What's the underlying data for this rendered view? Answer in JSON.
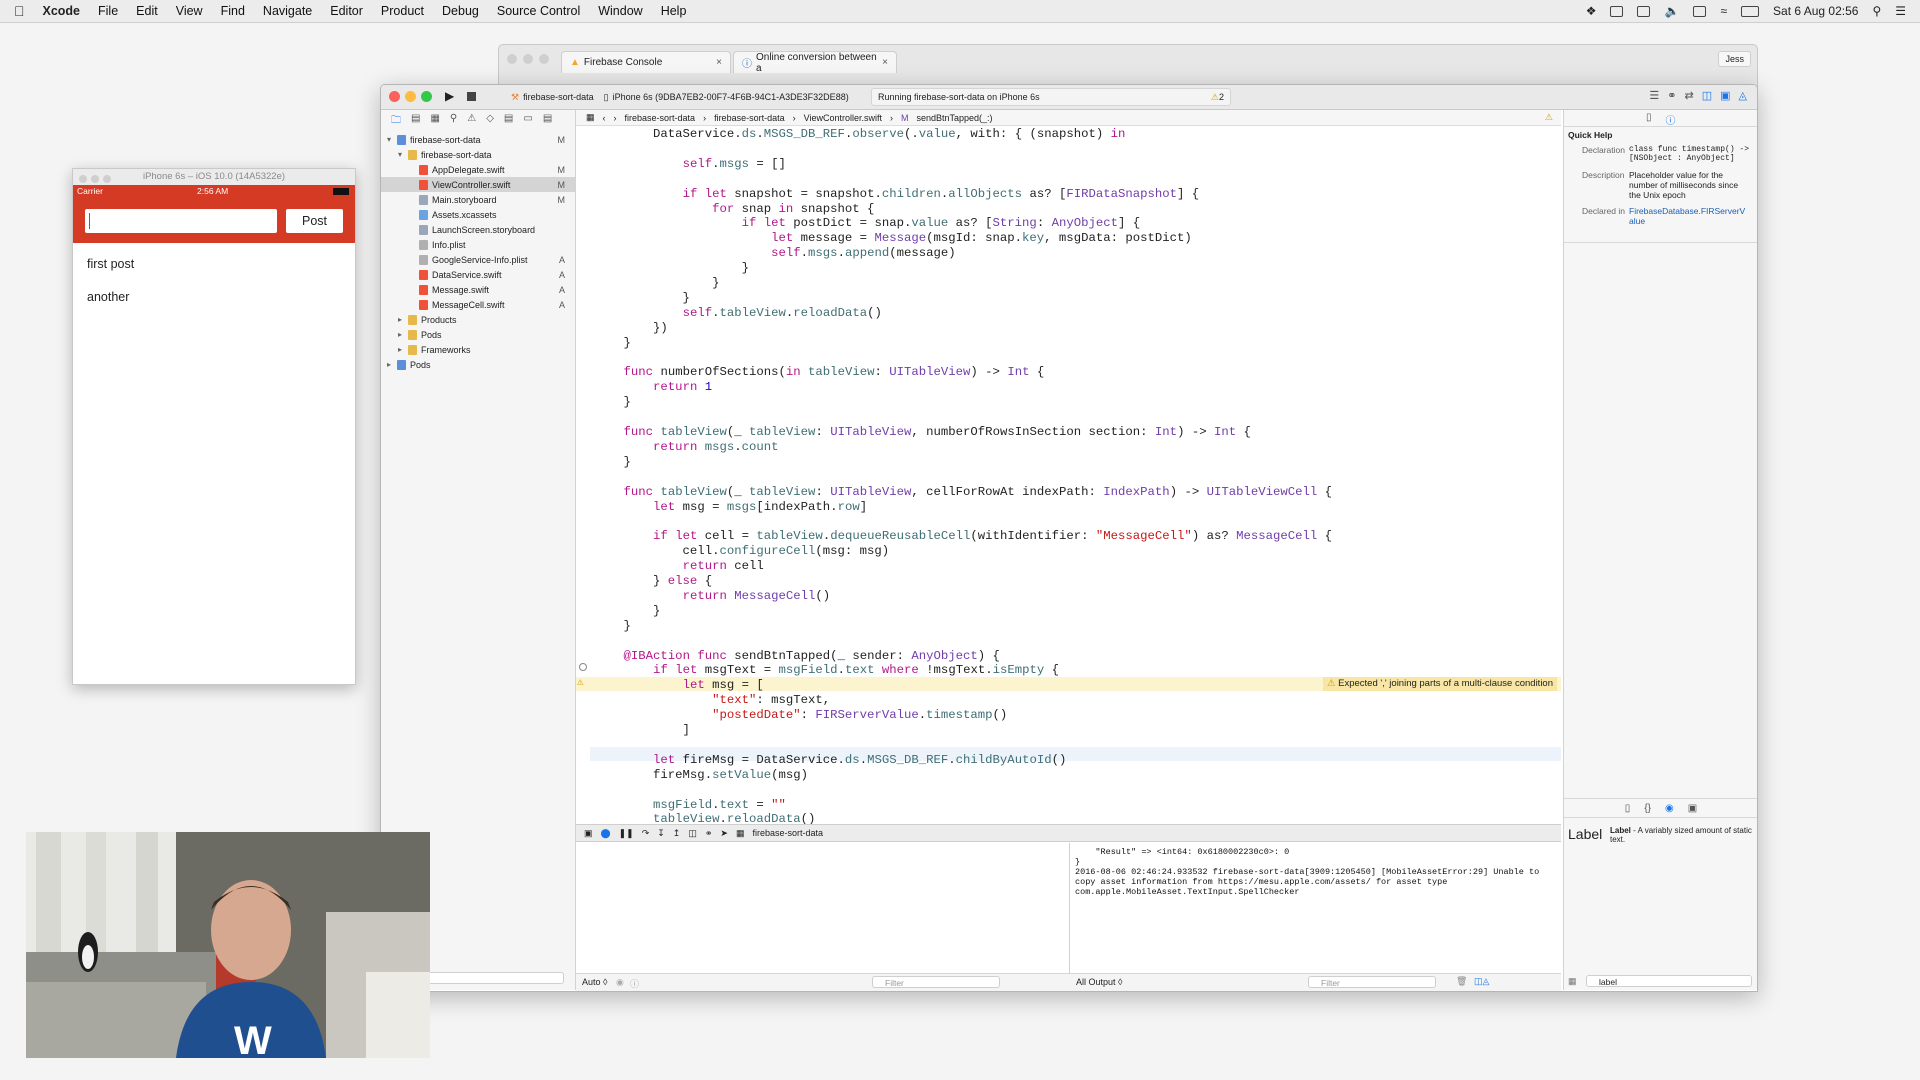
{
  "menubar": {
    "app": "Xcode",
    "items": [
      "File",
      "Edit",
      "View",
      "Find",
      "Navigate",
      "Editor",
      "Product",
      "Debug",
      "Source Control",
      "Window",
      "Help"
    ],
    "datetime": "Sat 6 Aug  02:56"
  },
  "browser": {
    "tabs": [
      "Firebase Console",
      "Online conversion between a"
    ],
    "profile": "Jess"
  },
  "xcode": {
    "scheme": "firebase-sort-data",
    "device": "iPhone 6s (9DBA7EB2-00F7-4F6B-94C1-A3DE3F32DE88)",
    "status": "Running firebase-sort-data on iPhone 6s",
    "warning_count": "2",
    "jumpbar": [
      "firebase-sort-data",
      "firebase-sort-data",
      "ViewController.swift",
      "sendBtnTapped(_:)"
    ],
    "navigator": [
      {
        "label": "firebase-sort-data",
        "status": "M",
        "indent": 0,
        "kind": "project"
      },
      {
        "label": "firebase-sort-data",
        "status": "",
        "indent": 1,
        "kind": "folder"
      },
      {
        "label": "AppDelegate.swift",
        "status": "M",
        "indent": 2,
        "kind": "swift"
      },
      {
        "label": "ViewController.swift",
        "status": "M",
        "indent": 2,
        "kind": "swift",
        "selected": true
      },
      {
        "label": "Main.storyboard",
        "status": "M",
        "indent": 2,
        "kind": "sb"
      },
      {
        "label": "Assets.xcassets",
        "status": "",
        "indent": 2,
        "kind": "asset"
      },
      {
        "label": "LaunchScreen.storyboard",
        "status": "",
        "indent": 2,
        "kind": "sb"
      },
      {
        "label": "Info.plist",
        "status": "",
        "indent": 2,
        "kind": "plist"
      },
      {
        "label": "GoogleService-Info.plist",
        "status": "A",
        "indent": 2,
        "kind": "plist"
      },
      {
        "label": "DataService.swift",
        "status": "A",
        "indent": 2,
        "kind": "swift"
      },
      {
        "label": "Message.swift",
        "status": "A",
        "indent": 2,
        "kind": "swift"
      },
      {
        "label": "MessageCell.swift",
        "status": "A",
        "indent": 2,
        "kind": "swift"
      },
      {
        "label": "Products",
        "status": "",
        "indent": 1,
        "kind": "folder"
      },
      {
        "label": "Pods",
        "status": "",
        "indent": 1,
        "kind": "folder"
      },
      {
        "label": "Frameworks",
        "status": "",
        "indent": 1,
        "kind": "folder"
      },
      {
        "label": "Pods",
        "status": "",
        "indent": 0,
        "kind": "project"
      }
    ],
    "code": [
      "        DataService.ds.MSGS_DB_REF.observe(.value, with: { (snapshot) in",
      "",
      "            self.msgs = []",
      "",
      "            if let snapshot = snapshot.children.allObjects as? [FIRDataSnapshot] {",
      "                for snap in snapshot {",
      "                    if let postDict = snap.value as? [String: AnyObject] {",
      "                        let message = Message(msgId: snap.key, msgData: postDict)",
      "                        self.msgs.append(message)",
      "                    }",
      "                }",
      "            }",
      "            self.tableView.reloadData()",
      "        })",
      "    }",
      "",
      "    func numberOfSections(in tableView: UITableView) -> Int {",
      "        return 1",
      "    }",
      "",
      "    func tableView(_ tableView: UITableView, numberOfRowsInSection section: Int) -> Int {",
      "        return msgs.count",
      "    }",
      "",
      "    func tableView(_ tableView: UITableView, cellForRowAt indexPath: IndexPath) -> UITableViewCell {",
      "        let msg = msgs[indexPath.row]",
      "",
      "        if let cell = tableView.dequeueReusableCell(withIdentifier: \"MessageCell\") as? MessageCell {",
      "            cell.configureCell(msg: msg)",
      "            return cell",
      "        } else {",
      "            return MessageCell()",
      "        }",
      "    }",
      "",
      "    @IBAction func sendBtnTapped(_ sender: AnyObject) {",
      "        if let msgText = msgField.text where !msgText.isEmpty {",
      "            let msg = [",
      "                \"text\": msgText,",
      "                \"postedDate\": FIRServerValue.timestamp()",
      "            ]",
      "",
      "        let fireMsg = DataService.ds.MSGS_DB_REF.childByAutoId()",
      "        fireMsg.setValue(msg)",
      "",
      "        msgField.text = \"\"",
      "        tableView.reloadData()",
      "        }",
      "",
      "    }",
      "",
      "}"
    ],
    "warning_message": "Expected ',' joining parts of a multi-clause condition",
    "debug_target": "firebase-sort-data",
    "console": "    \"Result\" => <int64: 0x6180002230c0>: 0\n}\n2016-08-06 02:46:24.933532 firebase-sort-data[3909:1205450] [MobileAssetError:29] Unable to copy asset information from https://mesu.apple.com/assets/ for asset type com.apple.MobileAsset.TextInput.SpellChecker",
    "bottom": {
      "auto": "Auto ◊",
      "filter": "Filter",
      "all_output": "All Output ◊",
      "filter2": "Filter"
    },
    "inspector": {
      "title": "Quick Help",
      "declaration_label": "Declaration",
      "declaration": "class func timestamp() -> [NSObject : AnyObject]",
      "description_label": "Description",
      "description": "Placeholder value for the number of milliseconds since the Unix epoch",
      "declared_label": "Declared in",
      "declared": "FirebaseDatabase.FIRServerValue",
      "library_title": "Label",
      "library_name": "Label",
      "library_desc": " - A variably sized amount of static text.",
      "search": "label"
    }
  },
  "simulator": {
    "title": "iPhone 6s – iOS 10.0 (14A5322e)",
    "carrier": "Carrier",
    "time": "2:56 AM",
    "post_button": "Post",
    "rows": [
      "first post",
      "another"
    ]
  }
}
